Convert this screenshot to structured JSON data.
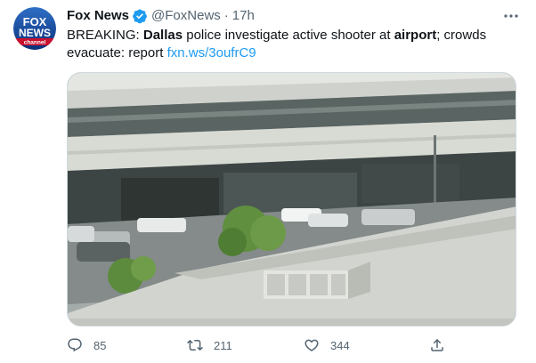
{
  "account": {
    "display_name": "Fox News",
    "handle": "@FoxNews",
    "separator": "·",
    "time": "17h",
    "avatar_text": [
      "FOX",
      "NEWS",
      "channel"
    ]
  },
  "tweet": {
    "text_parts": {
      "p1": "BREAKING: ",
      "p2": "Dallas",
      "p3": " police investigate active shooter at ",
      "p4": "airport",
      "p5": "; crowds evacuate: report ",
      "link": "fxn.ws/3oufrC9"
    }
  },
  "actions": {
    "reply_count": "85",
    "retweet_count": "211",
    "like_count": "344"
  },
  "icons": {
    "verified": "verified-badge-icon",
    "more": "more-options-icon",
    "reply": "reply-icon",
    "retweet": "retweet-icon",
    "like": "like-icon",
    "share": "share-icon"
  },
  "colors": {
    "accent": "#1d9bf0",
    "secondary_text": "#536471",
    "primary_text": "#0f1419"
  }
}
